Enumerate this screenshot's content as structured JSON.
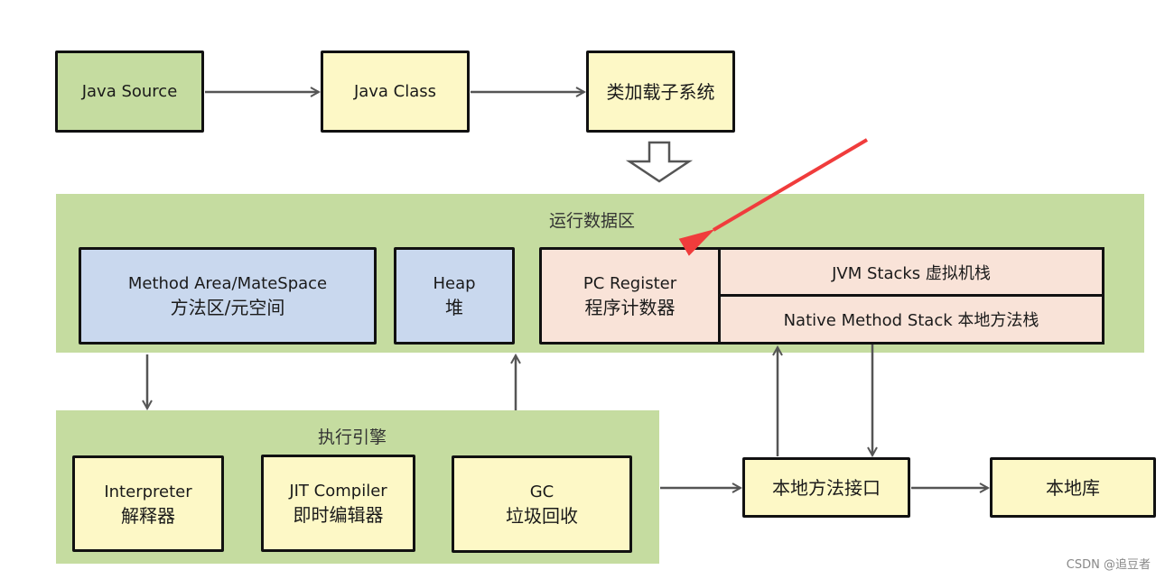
{
  "top_row": {
    "java_source": "Java Source",
    "java_class": "Java Class",
    "class_loader": "类加载子系统"
  },
  "runtime_data_area": {
    "title": "运行数据区",
    "method_area": {
      "en": "Method Area/MateSpace",
      "zh": "方法区/元空间"
    },
    "heap": {
      "en": "Heap",
      "zh": "堆"
    },
    "pc_register": {
      "en": "PC Register",
      "zh": "程序计数器"
    },
    "jvm_stacks": "JVM Stacks 虚拟机栈",
    "native_method_stack": "Native Method Stack 本地方法栈"
  },
  "execution_engine": {
    "title": "执行引擎",
    "interpreter": {
      "en": "Interpreter",
      "zh": "解释器"
    },
    "jit": {
      "en": "JIT Compiler",
      "zh": "即时编辑器"
    },
    "gc": {
      "en": "GC",
      "zh": "垃圾回收"
    }
  },
  "native_interface": "本地方法接口",
  "native_library": "本地库",
  "watermark": "CSDN @追豆者",
  "colors": {
    "green": "#c5dca0",
    "yellow": "#fdf8c6",
    "blue": "#c9d8ee",
    "pink": "#f9e3d8",
    "highlight_arrow": "#f03c3c"
  }
}
